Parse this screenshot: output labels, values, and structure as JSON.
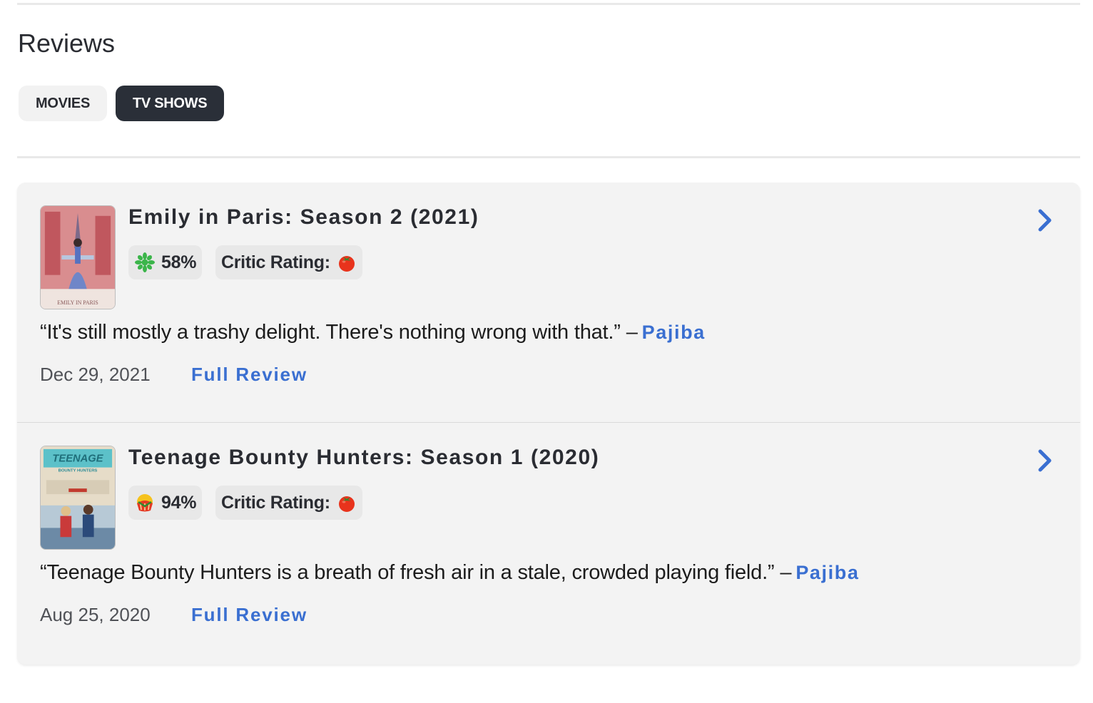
{
  "header": {
    "title": "Reviews"
  },
  "tabs": [
    {
      "label": "MOVIES",
      "active": false
    },
    {
      "label": "TV SHOWS",
      "active": true
    }
  ],
  "reviews": [
    {
      "title": "Emily in Paris: Season 2 (2021)",
      "audience_score": "58%",
      "audience_icon": "green-splat-icon",
      "critic_label": "Critic Rating:",
      "critic_icon": "tomato-icon",
      "quote": "“It's still mostly a trashy delight. There's nothing wrong with that.”",
      "dash": "–",
      "publication": "Pajiba",
      "date": "Dec 29, 2021",
      "full_review_label": "Full Review",
      "poster_text": "EMILY IN PARIS"
    },
    {
      "title": "Teenage Bounty Hunters: Season 1 (2020)",
      "audience_score": "94%",
      "audience_icon": "popcorn-icon",
      "critic_label": "Critic Rating:",
      "critic_icon": "tomato-icon",
      "quote": "“Teenage Bounty Hunters is a breath of fresh air in a stale, crowded playing field.”",
      "dash": "–",
      "publication": "Pajiba",
      "date": "Aug 25, 2020",
      "full_review_label": "Full Review",
      "poster_text": "TEENAGE BOUNTY HUNTERS"
    }
  ],
  "colors": {
    "link": "#3a6fd1",
    "active_tab": "#2a2f38",
    "card_bg": "#f3f3f3"
  }
}
